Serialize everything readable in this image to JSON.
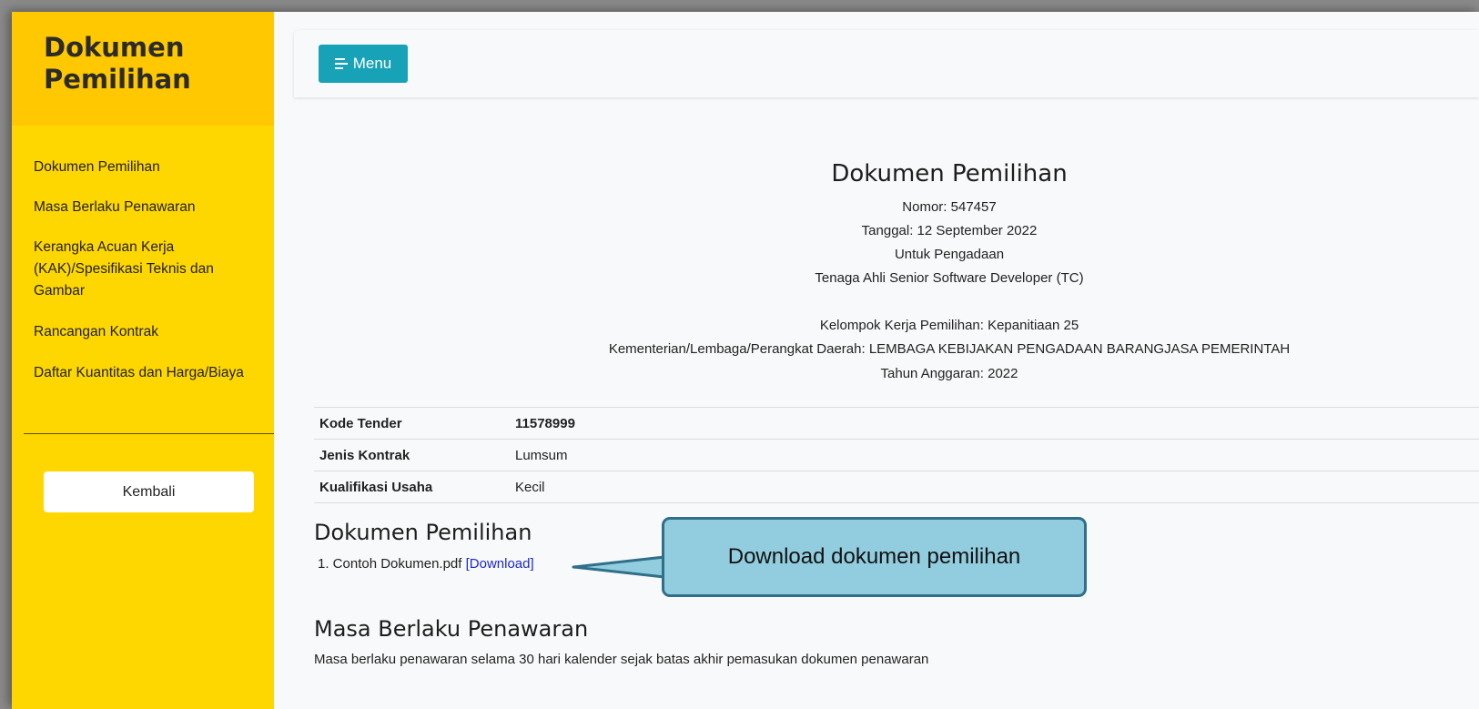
{
  "sidebar": {
    "title": "Dokumen Pemilihan",
    "items": [
      {
        "label": "Dokumen Pemilihan"
      },
      {
        "label": "Masa Berlaku Penawaran"
      },
      {
        "label": "Kerangka Acuan Kerja (KAK)/Spesifikasi Teknis dan Gambar"
      },
      {
        "label": "Rancangan Kontrak"
      },
      {
        "label": "Daftar Kuantitas dan Harga/Biaya"
      }
    ],
    "back_label": "Kembali"
  },
  "navbar": {
    "menu_label": "Menu",
    "menu_icon": "menu-lines-icon",
    "accent": "#17a2b8"
  },
  "document": {
    "title": "Dokumen Pemilihan",
    "nomor": "Nomor: 547457",
    "tanggal": "Tanggal: 12 September 2022",
    "untuk": "Untuk Pengadaan",
    "pengadaan": "Tenaga Ahli Senior Software Developer (TC)",
    "pokja": "Kelompok Kerja Pemilihan: Kepanitiaan 25",
    "kldi": "Kementerian/Lembaga/Perangkat Daerah: LEMBAGA KEBIJAKAN PENGADAAN BARANGJASA PEMERINTAH",
    "tahun": "Tahun Anggaran: 2022"
  },
  "info_table": [
    {
      "label": "Kode Tender",
      "value": "11578999"
    },
    {
      "label": "Jenis Kontrak",
      "value": "Lumsum"
    },
    {
      "label": "Kualifikasi Usaha",
      "value": "Kecil"
    }
  ],
  "dokumen_section": {
    "heading": "Dokumen Pemilihan",
    "file_text": "1. Contoh Dokumen.pdf",
    "download_label": "[Download]"
  },
  "masa_section": {
    "heading": "Masa Berlaku Penawaran",
    "text": "Masa berlaku penawaran selama 30 hari kalender sejak batas akhir pemasukan dokumen penawaran"
  },
  "callout": {
    "text": "Download dokumen pemilihan"
  },
  "colors": {
    "sidebar": "#ffd700",
    "sidebar_header": "#ffc800",
    "callout_fill": "#92cddf",
    "callout_border": "#2f6f8a",
    "link": "#1b27d6"
  }
}
